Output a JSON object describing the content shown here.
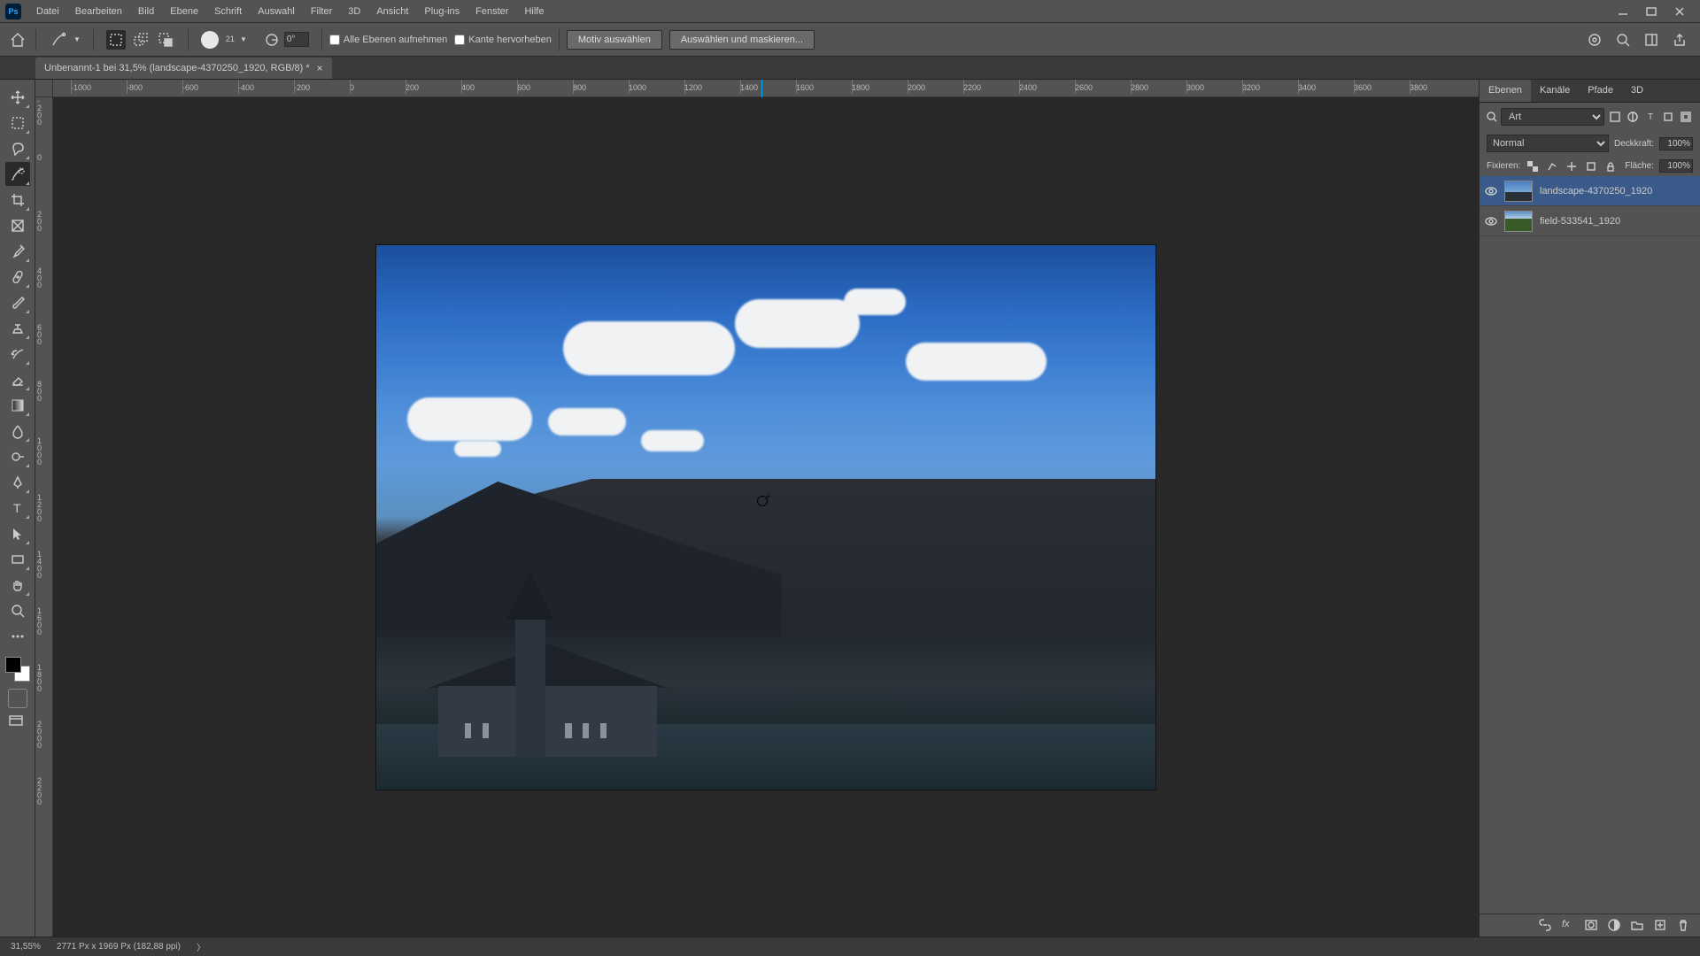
{
  "menu": [
    "Datei",
    "Bearbeiten",
    "Bild",
    "Ebene",
    "Schrift",
    "Auswahl",
    "Filter",
    "3D",
    "Ansicht",
    "Plug-ins",
    "Fenster",
    "Hilfe"
  ],
  "options": {
    "brush_size": "21",
    "angle": "0°",
    "check_all_layers": "Alle Ebenen aufnehmen",
    "check_enhance_edge": "Kante hervorheben",
    "btn_select_subject": "Motiv auswählen",
    "btn_select_mask": "Auswählen und maskieren..."
  },
  "doc_tab": "Unbenannt-1 bei 31,5% (landscape-4370250_1920, RGB/8) *",
  "ruler_h": [
    "-1000",
    "-800",
    "-600",
    "-400",
    "-200",
    "0",
    "200",
    "400",
    "600",
    "800",
    "1000",
    "1200",
    "1400",
    "1600",
    "1800",
    "2000",
    "2200",
    "2400",
    "2600",
    "2800",
    "3000",
    "3200",
    "3400",
    "3600",
    "3800"
  ],
  "ruler_v": [
    "-200",
    "0",
    "200",
    "400",
    "600",
    "800",
    "1000",
    "1200",
    "1400",
    "1600",
    "1800",
    "2000",
    "2200"
  ],
  "panels": {
    "tabs": [
      "Ebenen",
      "Kanäle",
      "Pfade",
      "3D"
    ],
    "filter_label": "Art",
    "blend_mode": "Normal",
    "opacity_label": "Deckkraft:",
    "opacity_value": "100%",
    "lock_label": "Fixieren:",
    "fill_label": "Fläche:",
    "fill_value": "100%",
    "layers": [
      {
        "name": "landscape-4370250_1920",
        "selected": true,
        "kind": "landscape"
      },
      {
        "name": "field-533541_1920",
        "selected": false,
        "kind": "field"
      }
    ]
  },
  "status": {
    "zoom": "31,55%",
    "doc_info": "2771 Px x 1969 Px (182,88 ppi)"
  }
}
